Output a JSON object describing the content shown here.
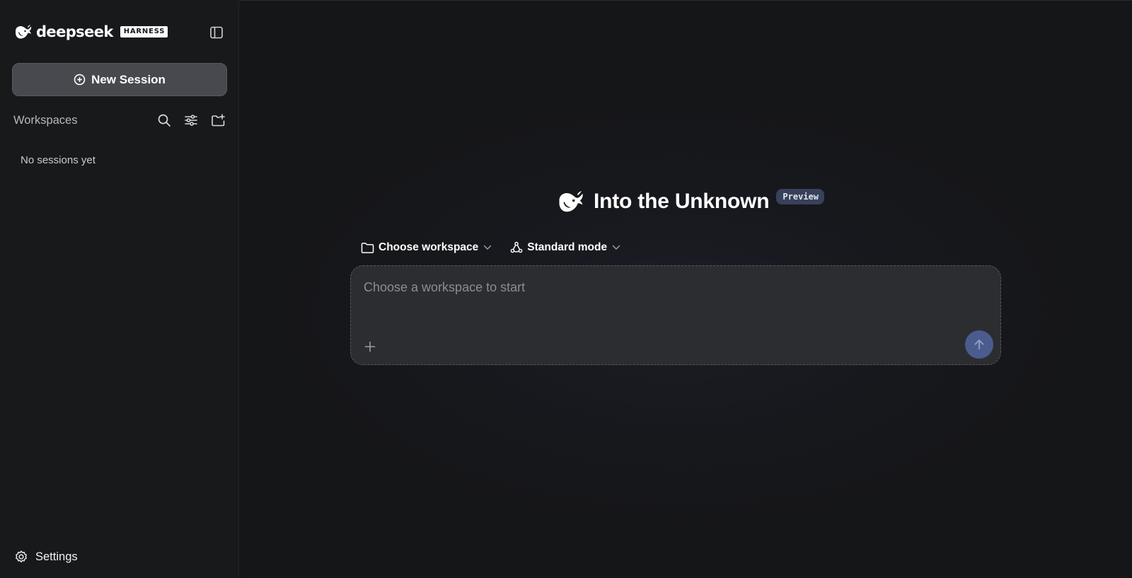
{
  "brand": {
    "name": "deepseek",
    "badge": "HARNESS",
    "logo_icon": "whale-logo-icon"
  },
  "sidebar": {
    "toggle_icon": "sidebar-toggle-icon",
    "new_session_label": "New Session",
    "workspaces_label": "Workspaces",
    "header_icons": [
      "search-icon",
      "filter-sliders-icon",
      "new-folder-icon"
    ],
    "empty_text": "No sessions yet",
    "settings_label": "Settings"
  },
  "main": {
    "title": "Into the Unknown",
    "badge": "Preview",
    "workspace_selector_label": "Choose workspace",
    "mode_selector_label": "Standard mode",
    "composer_placeholder": "Choose a workspace to start"
  },
  "colors": {
    "background": "#151618",
    "sidebar_bg": "#18191b",
    "new_session_bg": "#48494e",
    "composer_bg": "#2c2d30",
    "send_button": "#4a5c8e",
    "preview_badge": "#38415a"
  }
}
